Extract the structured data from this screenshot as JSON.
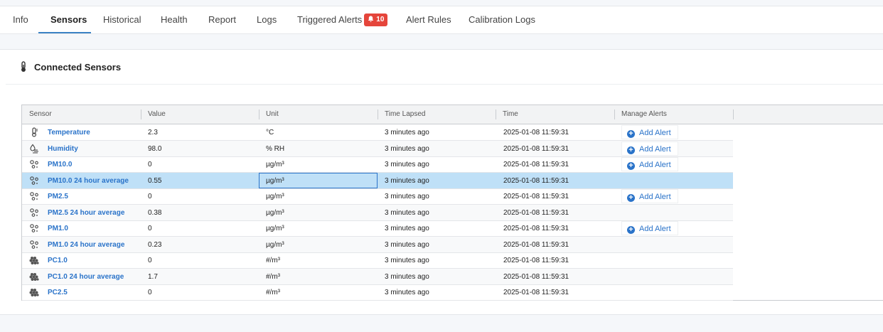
{
  "tabs": [
    {
      "label": "Info"
    },
    {
      "label": "Sensors",
      "active": true
    },
    {
      "label": "Historical"
    },
    {
      "label": "Health"
    },
    {
      "label": "Report"
    },
    {
      "label": "Logs"
    },
    {
      "label": "Triggered Alerts",
      "badge": "10"
    },
    {
      "label": "Alert Rules"
    },
    {
      "label": "Calibration Logs"
    }
  ],
  "panel": {
    "title": "Connected Sensors"
  },
  "grid": {
    "columns": [
      "Sensor",
      "Value",
      "Unit",
      "Time Lapsed",
      "Time",
      "Manage Alerts"
    ],
    "add_alert_label": "Add Alert",
    "rows": [
      {
        "icon": "thermometer-icon",
        "name": "Temperature",
        "value": "2.3",
        "unit": "°C",
        "lapsed": "3 minutes ago",
        "time": "2025-01-08 11:59:31",
        "alert": true
      },
      {
        "icon": "humidity-icon",
        "name": "Humidity",
        "value": "98.0",
        "unit": "% RH",
        "lapsed": "3 minutes ago",
        "time": "2025-01-08 11:59:31",
        "alert": true
      },
      {
        "icon": "particles-icon",
        "name": "PM10.0",
        "value": "0",
        "unit": "µg/m³",
        "lapsed": "3 minutes ago",
        "time": "2025-01-08 11:59:31",
        "alert": true
      },
      {
        "icon": "particles-icon",
        "name": "PM10.0 24 hour average",
        "value": "0.55",
        "unit": "µg/m³",
        "lapsed": "3 minutes ago",
        "time": "2025-01-08 11:59:31",
        "alert": false,
        "selected": true
      },
      {
        "icon": "particles-icon",
        "name": "PM2.5",
        "value": "0",
        "unit": "µg/m³",
        "lapsed": "3 minutes ago",
        "time": "2025-01-08 11:59:31",
        "alert": true
      },
      {
        "icon": "particles-icon",
        "name": "PM2.5 24 hour average",
        "value": "0.38",
        "unit": "µg/m³",
        "lapsed": "3 minutes ago",
        "time": "2025-01-08 11:59:31",
        "alert": false
      },
      {
        "icon": "particles-icon",
        "name": "PM1.0",
        "value": "0",
        "unit": "µg/m³",
        "lapsed": "3 minutes ago",
        "time": "2025-01-08 11:59:31",
        "alert": true
      },
      {
        "icon": "particles-icon",
        "name": "PM1.0 24 hour average",
        "value": "0.23",
        "unit": "µg/m³",
        "lapsed": "3 minutes ago",
        "time": "2025-01-08 11:59:31",
        "alert": false
      },
      {
        "icon": "particle-count-icon",
        "name": "PC1.0",
        "value": "0",
        "unit": "#/m³",
        "lapsed": "3 minutes ago",
        "time": "2025-01-08 11:59:31",
        "alert": false
      },
      {
        "icon": "particle-count-icon",
        "name": "PC1.0 24 hour average",
        "value": "1.7",
        "unit": "#/m³",
        "lapsed": "3 minutes ago",
        "time": "2025-01-08 11:59:31",
        "alert": false
      },
      {
        "icon": "particle-count-icon",
        "name": "PC2.5",
        "value": "0",
        "unit": "#/m³",
        "lapsed": "3 minutes ago",
        "time": "2025-01-08 11:59:31",
        "alert": false
      }
    ]
  },
  "colors": {
    "accent": "#2a73c9",
    "badge": "#e5453b",
    "selected_row": "#bfe0f7"
  }
}
